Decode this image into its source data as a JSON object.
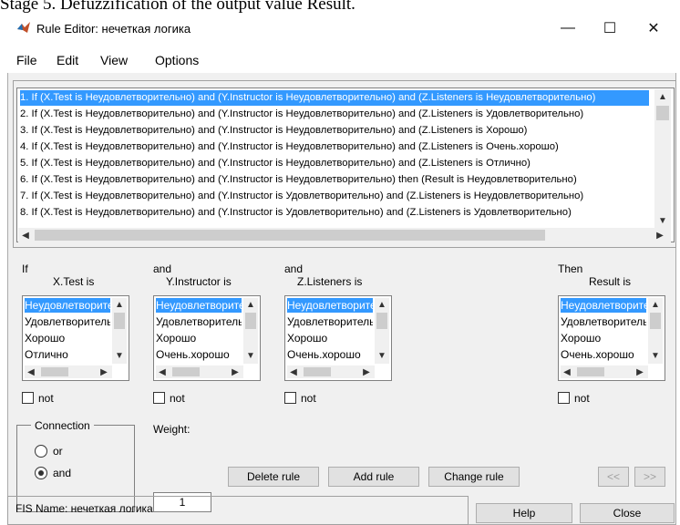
{
  "caption": "Stage 5. Defuzzification of the output value Result.",
  "window": {
    "title": "Rule Editor: нечеткая логика",
    "controls": {
      "minimize": "—",
      "maximize": "☐",
      "close": "✕"
    }
  },
  "menu": [
    "File",
    "Edit",
    "View",
    "Options"
  ],
  "rules": [
    "1. If (X.Test is Неудовлетворительно) and (Y.Instructor is Неудовлетворительно) and (Z.Listeners is Неудовлетворительно)",
    "2. If (X.Test is Неудовлетворительно) and (Y.Instructor is Неудовлетворительно) and (Z.Listeners is Удовлетворительно)",
    "3. If (X.Test is Неудовлетворительно) and (Y.Instructor is Неудовлетворительно) and (Z.Listeners is Хорошо)",
    "4. If (X.Test is Неудовлетворительно) and (Y.Instructor is Неудовлетворительно) and (Z.Listeners is Очень.хорошо)",
    "5. If (X.Test is Неудовлетворительно) and (Y.Instructor is Неудовлетворительно) and (Z.Listeners is Отлично)",
    "6. If (X.Test is Неудовлетворительно) and (Y.Instructor is Неудовлетворительно) then (Result is Неудовлетворительно)",
    "7. If (X.Test is Неудовлетворительно) and (Y.Instructor is Удовлетворительно) and (Z.Listeners is Неудовлетворительно)",
    "8. If (X.Test is Неудовлетворительно) and (Y.Instructor is Удовлетворительно) and (Z.Listeners is Удовлетворительно)"
  ],
  "panels": {
    "x": {
      "prefix": "If",
      "label": "X.Test is",
      "items": [
        "Неудовлетворительно",
        "Удовлетворительно",
        "Хорошо",
        "Отлично"
      ],
      "not": "not"
    },
    "y": {
      "prefix": "and",
      "label": "Y.Instructor is",
      "items": [
        "Неудовлетворительно",
        "Удовлетворительно",
        "Хорошо",
        "Очень.хорошо"
      ],
      "not": "not"
    },
    "z": {
      "prefix": "and",
      "label": "Z.Listeners is",
      "items": [
        "Неудовлетворительно",
        "Удовлетворительно",
        "Хорошо",
        "Очень.хорошо"
      ],
      "not": "not"
    },
    "result": {
      "prefix": "Then",
      "label": "Result is",
      "items": [
        "Неудовлетворительно",
        "Удовлетворительно",
        "Хорошо",
        "Очень.хорошо"
      ],
      "not": "not"
    }
  },
  "connection": {
    "title": "Connection",
    "or": "or",
    "and": "and",
    "selected": "and"
  },
  "weight": {
    "label": "Weight:",
    "value": "1"
  },
  "buttons": {
    "delete": "Delete rule",
    "add": "Add rule",
    "change": "Change rule",
    "prev": "<<",
    "next": ">>",
    "help": "Help",
    "close": "Close"
  },
  "status": "FIS Name: нечеткая логика",
  "colors": {
    "selection": "#3399ff",
    "window_bg": "#f0f0f0"
  }
}
